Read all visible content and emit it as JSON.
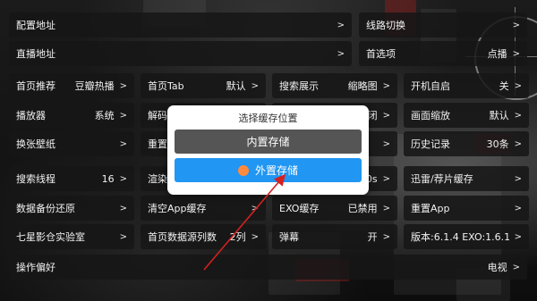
{
  "rows": [
    [
      {
        "label": "配置地址",
        "value": ""
      },
      {
        "label": "线路切换",
        "value": ""
      }
    ],
    [
      {
        "label": "直播地址",
        "value": ""
      },
      {
        "label": "首选项",
        "value": "点播"
      }
    ],
    [
      {
        "label": "首页推荐",
        "value": "豆瓣热播"
      },
      {
        "label": "首页Tab",
        "value": "默认"
      },
      {
        "label": "搜索展示",
        "value": "缩略图"
      },
      {
        "label": "开机自启",
        "value": "关"
      }
    ],
    [
      {
        "label": "播放器",
        "value": "系统"
      },
      {
        "label": "解码",
        "value": ""
      },
      {
        "label": "",
        "value": "闭"
      },
      {
        "label": "画面缩放",
        "value": "默认"
      }
    ],
    [
      {
        "label": "换张壁纸",
        "value": ""
      },
      {
        "label": "重置",
        "value": ""
      },
      {
        "label": "",
        "value": ""
      },
      {
        "label": "历史记录",
        "value": "30条"
      }
    ],
    [
      {
        "label": "搜索线程",
        "value": "16"
      },
      {
        "label": "渲染",
        "value": ""
      },
      {
        "label": "",
        "value": "0s"
      },
      {
        "label": "迅雷/荐片缓存",
        "value": ""
      }
    ],
    [
      {
        "label": "数据备份还原",
        "value": ""
      },
      {
        "label": "清空App缓存",
        "value": ""
      },
      {
        "label": "EXO缓存",
        "value": "已禁用"
      },
      {
        "label": "重置App",
        "value": ""
      }
    ],
    [
      {
        "label": "七星影仓实验室",
        "value": ""
      },
      {
        "label": "首页数据源列数",
        "value": "2列"
      },
      {
        "label": "弹幕",
        "value": "开"
      },
      {
        "label": "版本:6.1.4 EXO:1.6.1",
        "value": ""
      }
    ],
    [
      {
        "label": "操作偏好",
        "value": "电视"
      }
    ]
  ],
  "chevron": ">",
  "modal": {
    "title": "选择缓存位置",
    "options": [
      "内置存储",
      "外置存储"
    ]
  },
  "colors": {
    "cell_bg": "#161616",
    "accent": "#2196f3",
    "dot": "#ff8a3d",
    "arrow": "#d42020"
  },
  "icons": {
    "chevron": "chevron-right-icon",
    "dot": "orange-dot-icon"
  }
}
